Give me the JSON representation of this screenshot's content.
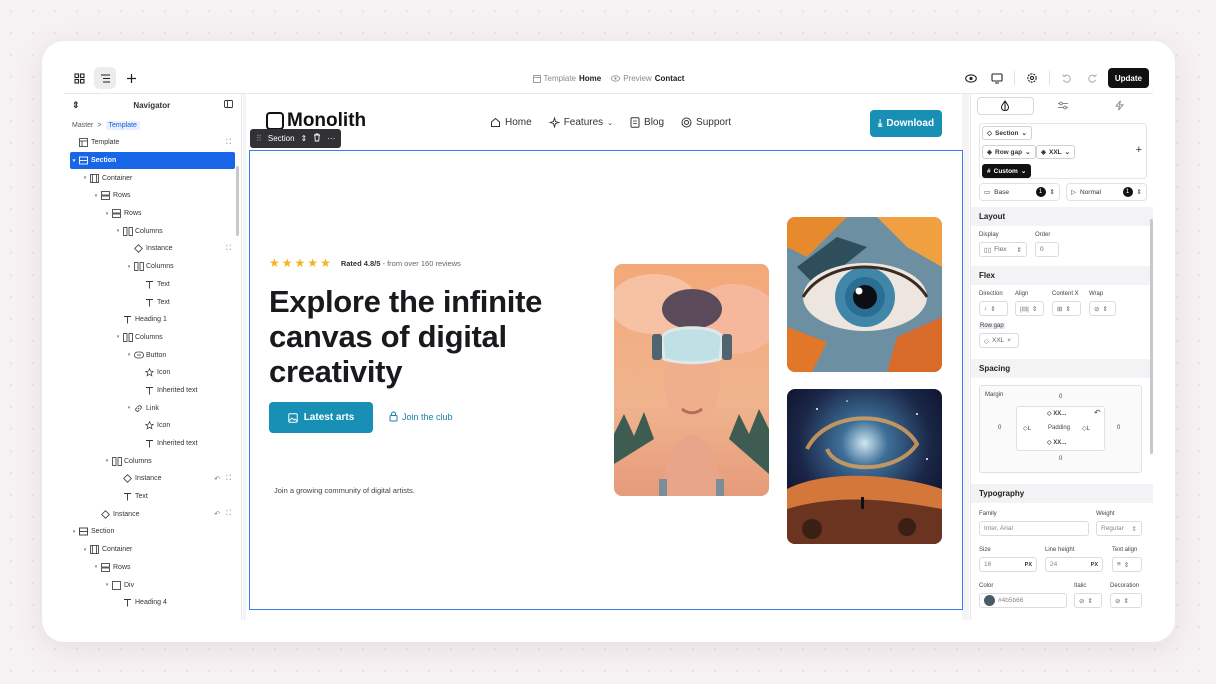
{
  "topbar": {
    "center_template_label": "Template",
    "center_template_value": "Home",
    "center_preview_label": "Preview",
    "center_preview_value": "Contact",
    "update_label": "Update"
  },
  "navigator": {
    "title": "Navigator",
    "breadcrumb": [
      "Master",
      "Template"
    ],
    "tree": [
      {
        "label": "Template",
        "depth": 0,
        "icon": "layout-icon",
        "caret": false
      },
      {
        "label": "Section",
        "depth": 0,
        "icon": "section-icon",
        "caret": true,
        "selected": true
      },
      {
        "label": "Container",
        "depth": 1,
        "icon": "container-icon",
        "caret": true
      },
      {
        "label": "Rows",
        "depth": 2,
        "icon": "rows-icon",
        "caret": true
      },
      {
        "label": "Rows",
        "depth": 3,
        "icon": "rows-icon",
        "caret": true
      },
      {
        "label": "Columns",
        "depth": 4,
        "icon": "columns-icon",
        "caret": true
      },
      {
        "label": "Instance",
        "depth": 5,
        "icon": "instance-icon",
        "caret": false
      },
      {
        "label": "Columns",
        "depth": 5,
        "icon": "columns-icon",
        "caret": true
      },
      {
        "label": "Text",
        "depth": 6,
        "icon": "text-icon",
        "caret": false
      },
      {
        "label": "Text",
        "depth": 6,
        "icon": "text-icon",
        "caret": false
      },
      {
        "label": "Heading 1",
        "depth": 4,
        "icon": "text-icon",
        "caret": false
      },
      {
        "label": "Columns",
        "depth": 4,
        "icon": "columns-icon",
        "caret": true
      },
      {
        "label": "Button",
        "depth": 5,
        "icon": "button-icon",
        "caret": true
      },
      {
        "label": "Icon",
        "depth": 6,
        "icon": "star-icon",
        "caret": false
      },
      {
        "label": "Inherited text",
        "depth": 6,
        "icon": "text-icon",
        "caret": false
      },
      {
        "label": "Link",
        "depth": 5,
        "icon": "link-icon",
        "caret": true
      },
      {
        "label": "Icon",
        "depth": 6,
        "icon": "star-icon",
        "caret": false
      },
      {
        "label": "Inherited text",
        "depth": 6,
        "icon": "text-icon",
        "caret": false
      },
      {
        "label": "Columns",
        "depth": 3,
        "icon": "columns-icon",
        "caret": true
      },
      {
        "label": "Instance",
        "depth": 4,
        "icon": "instance-icon",
        "caret": false
      },
      {
        "label": "Text",
        "depth": 4,
        "icon": "text-icon",
        "caret": false
      },
      {
        "label": "Instance",
        "depth": 2,
        "icon": "instance-icon",
        "caret": false
      },
      {
        "label": "Section",
        "depth": 0,
        "icon": "section-icon",
        "caret": true
      },
      {
        "label": "Container",
        "depth": 1,
        "icon": "container-icon",
        "caret": true
      },
      {
        "label": "Rows",
        "depth": 2,
        "icon": "rows-icon",
        "caret": true
      },
      {
        "label": "Div",
        "depth": 3,
        "icon": "div-icon",
        "caret": true
      },
      {
        "label": "Heading 4",
        "depth": 4,
        "icon": "text-icon",
        "caret": false
      }
    ]
  },
  "site": {
    "logo": "Monolith",
    "menu": [
      "Home",
      "Features",
      "Blog",
      "Support"
    ],
    "download_label": "Download",
    "section_label": "Section",
    "rating_text": "Rated 4.8/5",
    "rating_sub": " - from over 160 reviews",
    "hero_title": "Explore the infinite canvas of digital creativity",
    "cta_label": "Latest arts",
    "join_label": "Join the club",
    "community_text": "Join a growing community of digital artists."
  },
  "props": {
    "chip_section": "Section",
    "chip_rowgap": "Row gap",
    "chip_xxl": "XXL",
    "chip_custom": "Custom",
    "state_base": "Base",
    "state_normal": "Normal",
    "state_count": "1",
    "layout": {
      "title": "Layout",
      "display_label": "Display",
      "display_value": "Flex",
      "order_label": "Order",
      "order_value": "0"
    },
    "flex": {
      "title": "Flex",
      "direction": "Direction",
      "align": "Align",
      "content_x": "Content X",
      "wrap": "Wrap",
      "row_gap": "Row gap",
      "row_gap_value": "XXL"
    },
    "spacing": {
      "title": "Spacing",
      "margin": "Margin",
      "padding": "Padding",
      "m_top": "0",
      "m_bottom": "0",
      "m_left": "0",
      "m_right": "0",
      "p_top": "XX...",
      "p_bottom": "XX...",
      "p_left": "L",
      "p_right": "L"
    },
    "typography": {
      "title": "Typography",
      "family_label": "Family",
      "family_value": "Inter, Arial",
      "weight_label": "Weight",
      "weight_value": "Regular",
      "size_label": "Size",
      "size_value": "16",
      "size_unit": "PX",
      "lh_label": "Line height",
      "lh_value": "24",
      "lh_unit": "PX",
      "align_label": "Text align",
      "color_label": "Color",
      "color_value": "#4b5b66",
      "italic_label": "Italic",
      "decoration_label": "Decoration"
    }
  },
  "colors": {
    "accent": "#1890b6",
    "selection": "#1865e8",
    "text_color_swatch": "#4b5b66"
  }
}
